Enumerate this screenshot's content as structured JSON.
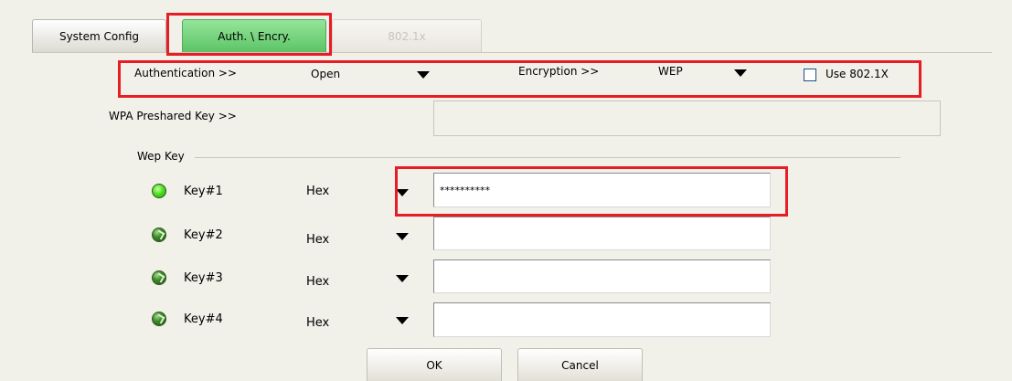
{
  "tabs": {
    "system_config": "System Config",
    "auth_encry": "Auth. \\ Encry.",
    "dot1x": "802.1x"
  },
  "auth_row": {
    "authentication_label": "Authentication >>",
    "authentication_value": "Open",
    "encryption_label": "Encryption >>",
    "encryption_value": "WEP",
    "use_8021x_label": "Use 802.1X",
    "use_8021x_checked": false
  },
  "wpa": {
    "label": "WPA Preshared Key >>",
    "value": ""
  },
  "wep": {
    "group_label": "Wep Key",
    "keys": [
      {
        "label": "Key#1",
        "format": "Hex",
        "value": "**********",
        "selected": true
      },
      {
        "label": "Key#2",
        "format": "Hex",
        "value": "",
        "selected": false
      },
      {
        "label": "Key#3",
        "format": "Hex",
        "value": "",
        "selected": false
      },
      {
        "label": "Key#4",
        "format": "Hex",
        "value": "",
        "selected": false
      }
    ]
  },
  "buttons": {
    "ok": "OK",
    "cancel": "Cancel"
  },
  "colors": {
    "background": "#f1f0e9",
    "active_tab": "#5cc466",
    "highlight": "#e81c24"
  }
}
